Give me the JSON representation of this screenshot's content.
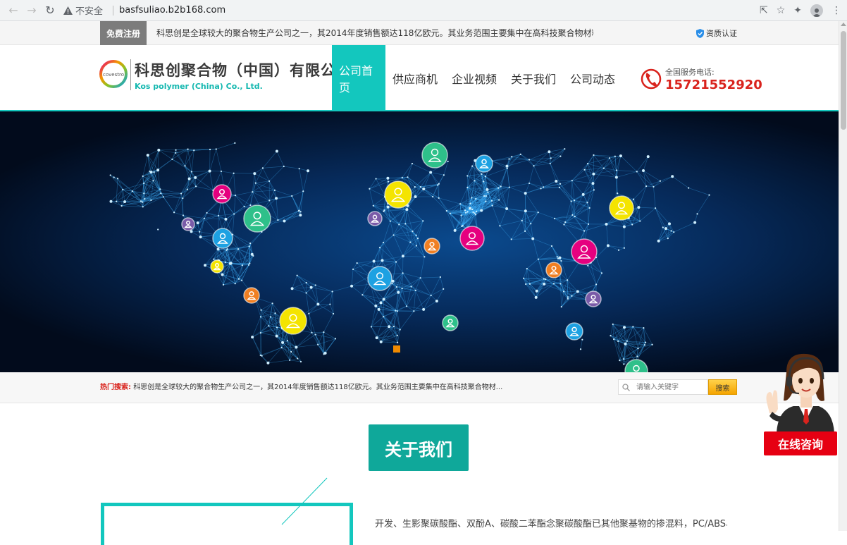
{
  "browser": {
    "insecure_label": "不安全",
    "url": "basfsuliao.b2b168.com"
  },
  "topbar": {
    "register_label": "免费注册",
    "intro": "科思创是全球较大的聚合物生产公司之一，其2014年度销售额达118亿欧元。其业务范围主要集中在高科技聚合物材料制造及应...",
    "cert_label": "资质认证"
  },
  "header": {
    "logo_text": "covestro",
    "brand_cn": "科思创聚合物（中国）有限公司",
    "brand_en": "Kos polymer (China) Co., Ltd.",
    "nav": [
      {
        "label": "公司首页",
        "active": true
      },
      {
        "label": "供应商机",
        "active": false
      },
      {
        "label": "企业视频",
        "active": false
      },
      {
        "label": "关于我们",
        "active": false
      },
      {
        "label": "公司动态",
        "active": false
      }
    ],
    "phone_label": "全国服务电话:",
    "phone_number": "15721552920"
  },
  "search": {
    "hot_label": "热门搜索:",
    "hot_text": "科思创是全球较大的聚合物生产公司之一，其2014年度销售额达118亿欧元。其业务范围主要集中在高科技聚合物材...",
    "placeholder": "请输入关键字",
    "button_label": "搜索"
  },
  "about": {
    "title": "关于我们",
    "text": "开发、生影聚碳酸酯、双酚A、碳酸二苯酯念聚碳酸酯已其他聚基物的掺混料，PC/ABS、PC"
  },
  "consult": {
    "label": "在线咨询"
  },
  "colors": {
    "accent": "#13c7be",
    "phone_red": "#d9231d",
    "consult_red": "#e60012"
  }
}
